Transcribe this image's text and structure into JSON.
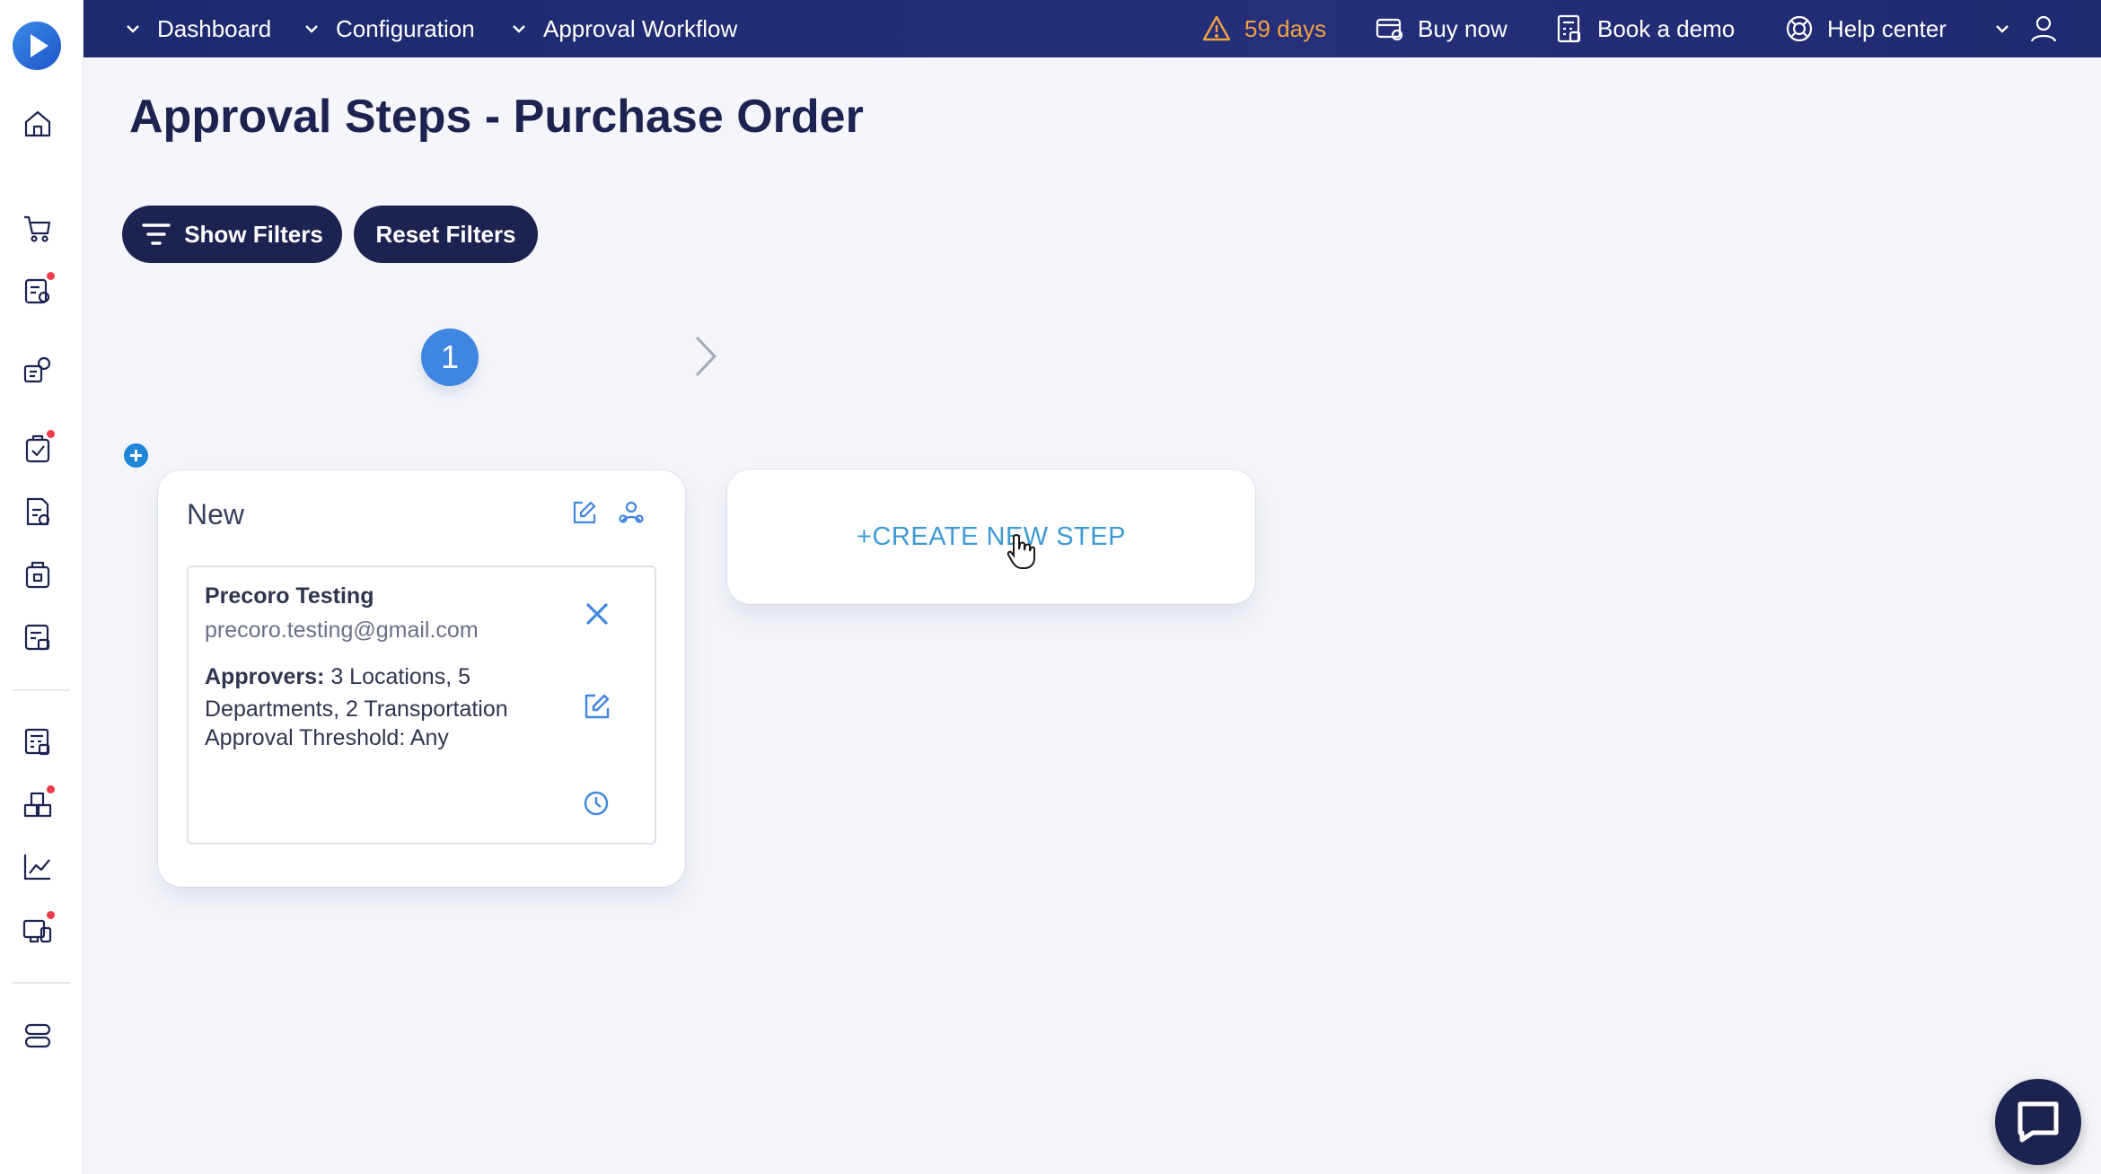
{
  "breadcrumbs": {
    "dashboard": "Dashboard",
    "configuration": "Configuration",
    "approval_workflow": "Approval Workflow"
  },
  "topbar": {
    "trial": "59 days",
    "buy_now": "Buy now",
    "book_demo": "Book a demo",
    "help_center": "Help center"
  },
  "page": {
    "title": "Approval Steps - Purchase Order"
  },
  "filters": {
    "show": "Show Filters",
    "reset": "Reset Filters"
  },
  "steps": {
    "current_number": "1"
  },
  "step_card": {
    "title": "New",
    "approver": {
      "name": "Precoro Testing",
      "email": "precoro.testing@gmail.com",
      "approvers_label": "Approvers:",
      "approvers_value": " 3 Locations, 5 Departments, 2 Transportation",
      "threshold": "Approval Threshold: Any"
    }
  },
  "create_step": {
    "label": "+CREATE NEW STEP"
  },
  "icons": {
    "sidebar": [
      "home-icon",
      "cart-icon",
      "requests-icon",
      "suppliers-icon",
      "orders-icon",
      "invoices-icon",
      "receipts-icon",
      "payments-icon",
      "budgets-icon",
      "warehouse-icon",
      "analytics-icon",
      "transfers-icon",
      "settings-icon"
    ],
    "topbar": [
      "warning-icon",
      "card-icon",
      "calculator-icon",
      "lifebuoy-icon",
      "user-icon"
    ]
  },
  "colors": {
    "navy": "#1c2350",
    "topbar": "#1f2a6f",
    "accent_blue": "#3f86e0",
    "link_blue": "#3d9ad3",
    "warning": "#f2a241",
    "badge_red": "#ef3b4a"
  }
}
